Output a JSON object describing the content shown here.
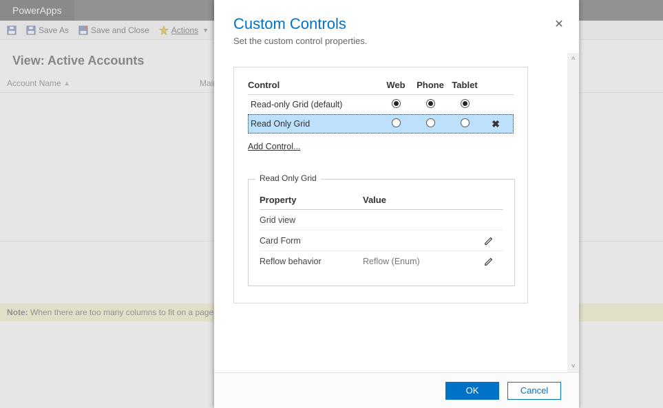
{
  "app": {
    "title": "PowerApps"
  },
  "toolbar": {
    "save_as": "Save As",
    "save_close": "Save and Close",
    "actions": "Actions"
  },
  "view": {
    "title": "View: Active Accounts",
    "columns": {
      "name": "Account Name",
      "main": "Main"
    }
  },
  "note": {
    "label": "Note:",
    "text": " When there are too many columns to fit on a page, the view will"
  },
  "dialog": {
    "title": "Custom Controls",
    "subtitle": "Set the custom control properties.",
    "close_tooltip": "Close",
    "table": {
      "headers": {
        "control": "Control",
        "web": "Web",
        "phone": "Phone",
        "tablet": "Tablet"
      },
      "rows": [
        {
          "name": "Read-only Grid (default)",
          "web": true,
          "phone": true,
          "tablet": true,
          "selected": false,
          "removable": false
        },
        {
          "name": "Read Only Grid",
          "web": false,
          "phone": false,
          "tablet": false,
          "selected": true,
          "removable": true
        }
      ],
      "add_link": "Add Control..."
    },
    "props": {
      "legend": "Read Only Grid",
      "headers": {
        "property": "Property",
        "value": "Value"
      },
      "rows": [
        {
          "name": "Grid view",
          "value": "",
          "editable": false
        },
        {
          "name": "Card Form",
          "value": "",
          "editable": true
        },
        {
          "name": "Reflow behavior",
          "value": "Reflow (Enum)",
          "editable": true
        }
      ]
    },
    "buttons": {
      "ok": "OK",
      "cancel": "Cancel"
    }
  }
}
